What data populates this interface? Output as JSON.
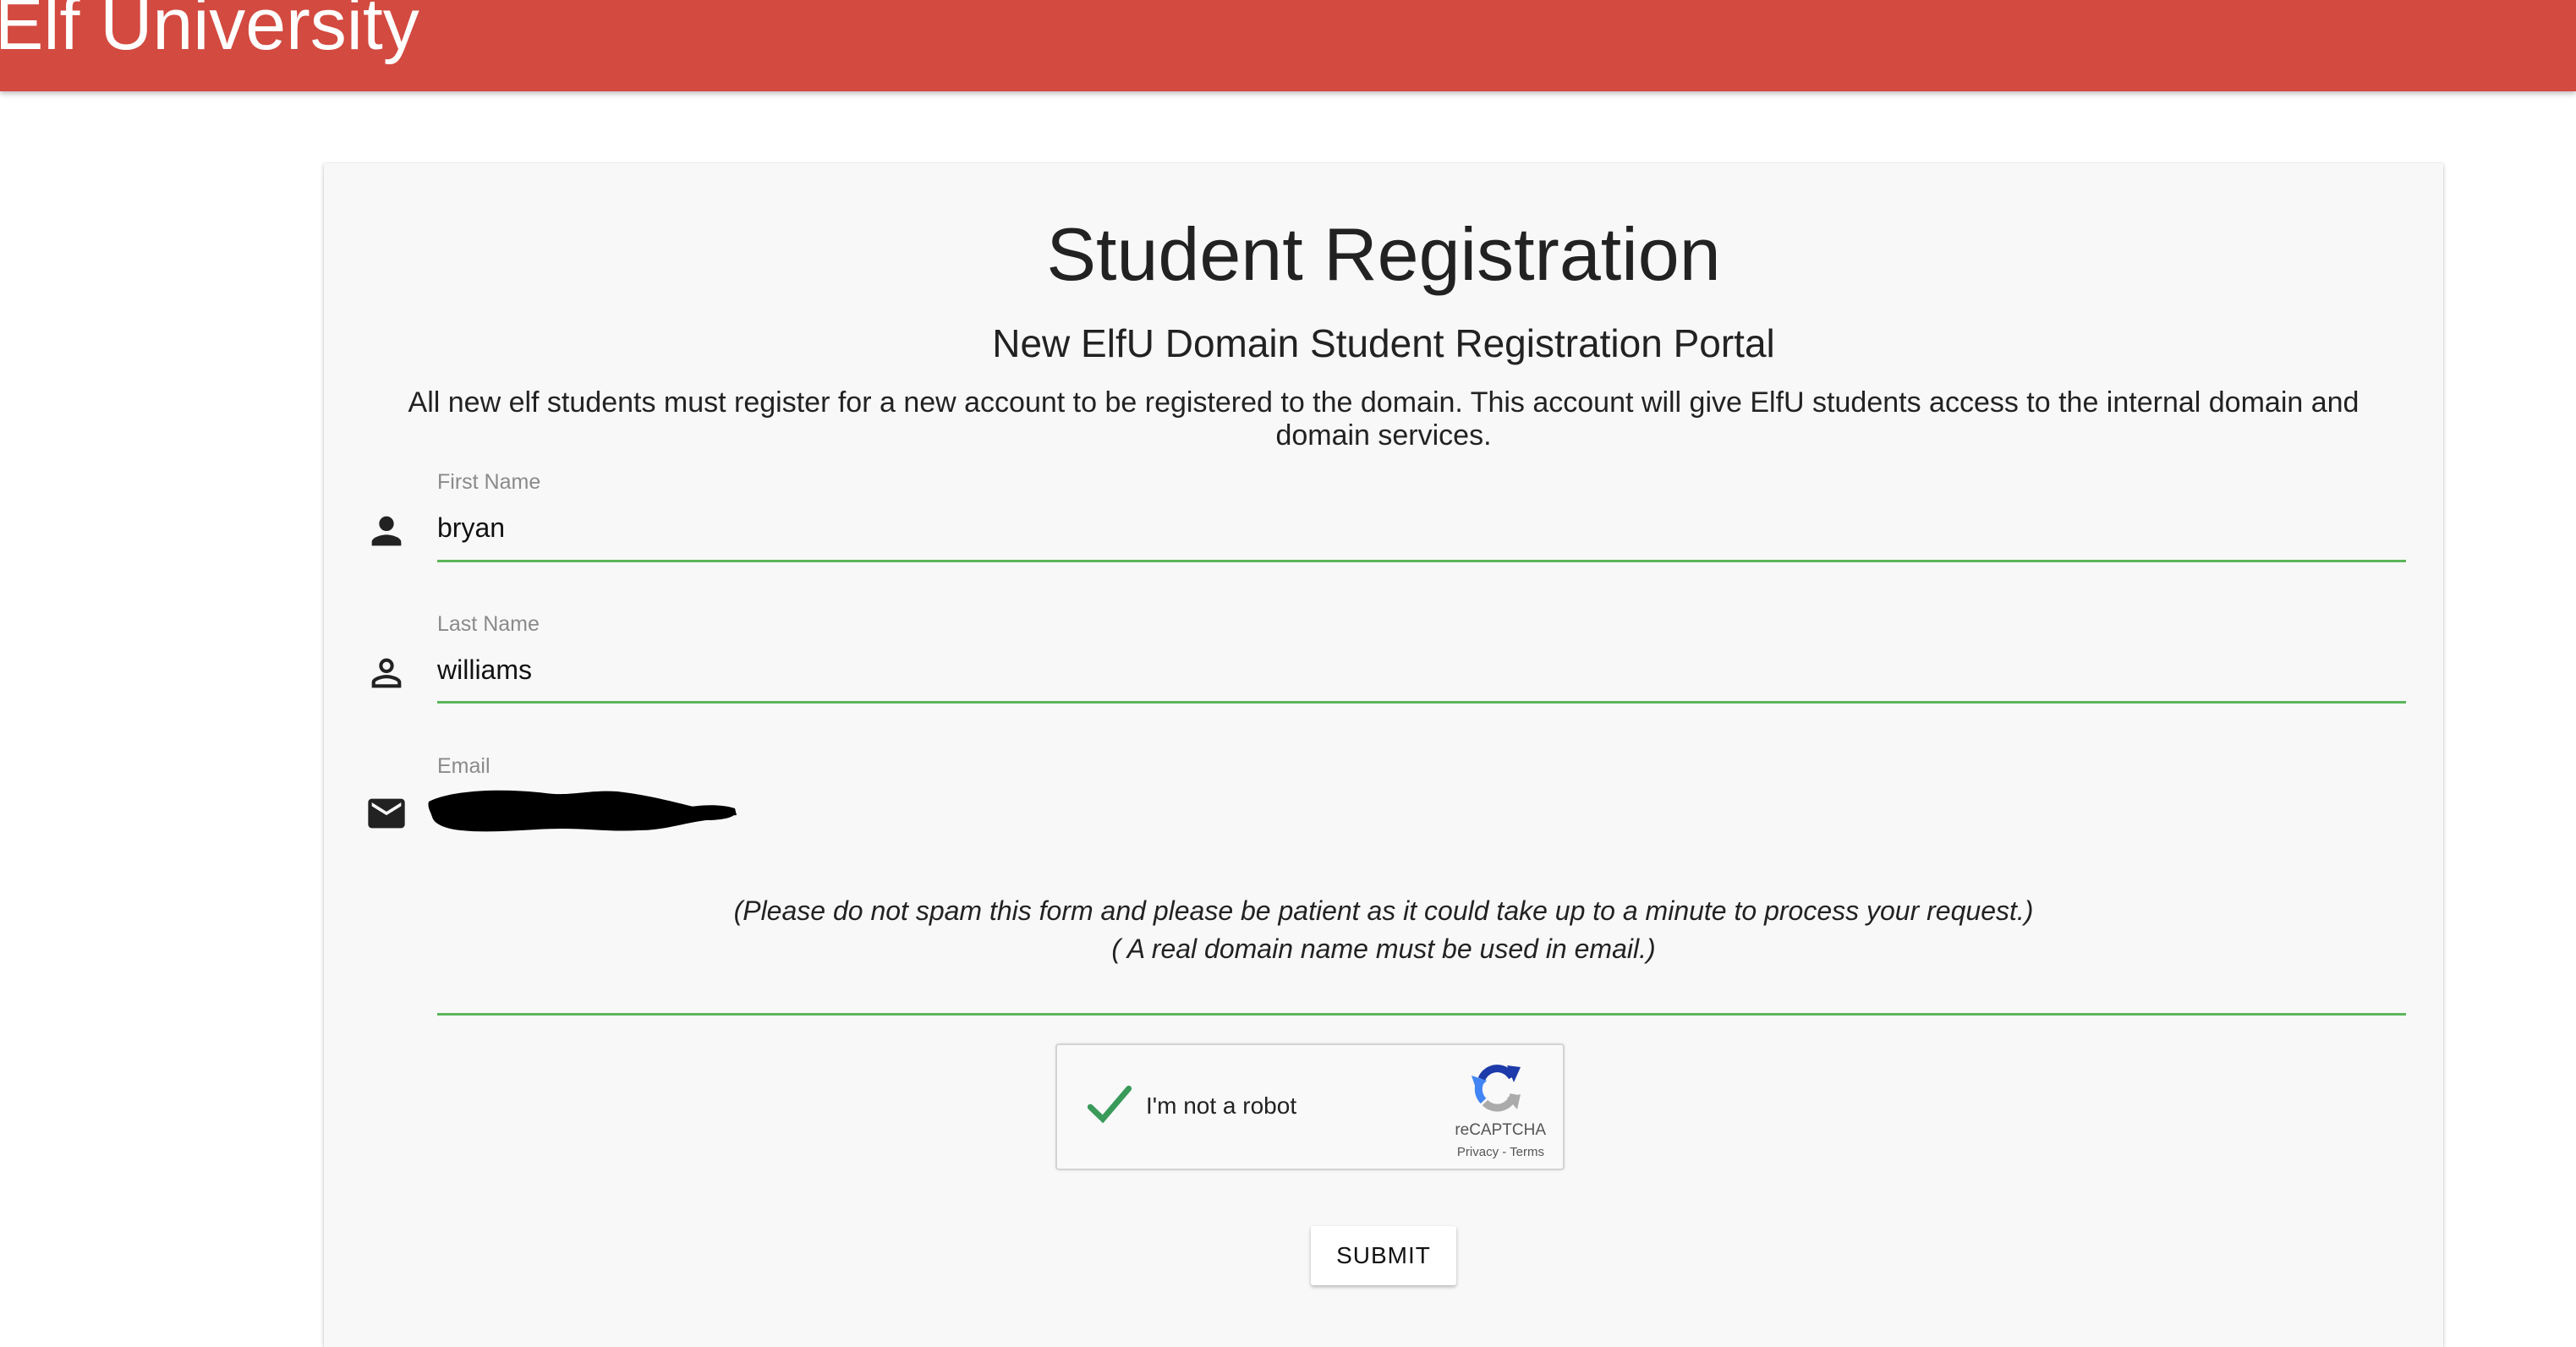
{
  "header": {
    "brand": "Elf University",
    "color": "#d34a40"
  },
  "card": {
    "title": "Student Registration",
    "subtitle": "New ElfU Domain Student Registration Portal",
    "intro": "All new elf students must register for a new account to be registered to the domain. This account will give ElfU students access to the internal domain and domain services."
  },
  "form": {
    "first_name": {
      "label": "First Name",
      "value": "bryan",
      "icon": "person-filled-icon"
    },
    "last_name": {
      "label": "Last Name",
      "value": "williams",
      "icon": "person-outline-icon"
    },
    "email": {
      "label": "Email",
      "value": "",
      "icon": "mail-icon",
      "redacted": true
    },
    "accent_color": "#5bb55a",
    "notes": [
      "(Please do not spam this form and please be patient as it could take up to a minute to process your request.)",
      "( A real domain name must be used in email.)"
    ],
    "recaptcha": {
      "checked": true,
      "label": "I'm not a robot",
      "brand": "reCAPTCHA",
      "links": "Privacy - Terms"
    },
    "submit_label": "SUBMIT"
  }
}
